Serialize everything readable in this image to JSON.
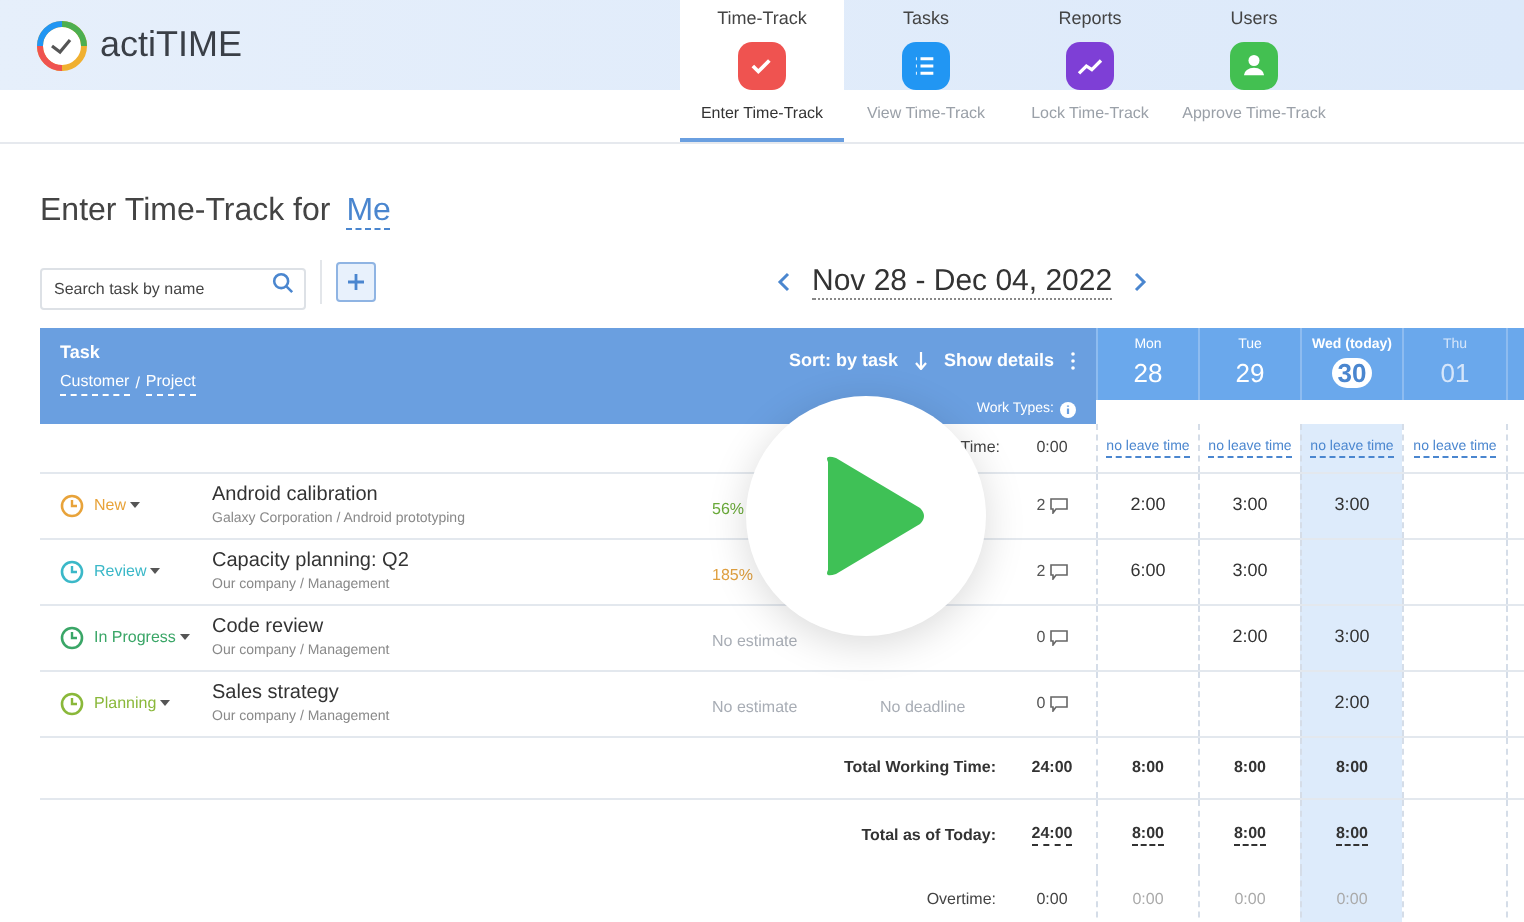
{
  "header": {
    "logo": "actiTIME",
    "tabs": [
      {
        "label": "Time-Track",
        "selected": true,
        "kind": "check"
      },
      {
        "label": "Tasks",
        "selected": false,
        "kind": "list"
      },
      {
        "label": "Reports",
        "selected": false,
        "kind": "chart"
      },
      {
        "label": "Users",
        "selected": false,
        "kind": "user"
      }
    ]
  },
  "subtabs": [
    {
      "label": "Enter Time-Track",
      "selected": true
    },
    {
      "label": "View Time-Track",
      "selected": false
    },
    {
      "label": "Lock Time-Track",
      "selected": false
    },
    {
      "label": "Approve Time-Track",
      "selected": false
    }
  ],
  "title": "Enter Time-Track for",
  "user": "Me",
  "search": {
    "placeholder": "Search task by name"
  },
  "date_range": "Nov 28 - Dec 04, 2022",
  "table": {
    "task_header": "Task",
    "customer_link": "Customer",
    "separator": "/",
    "project_link": "Project",
    "sort": "Sort: by task",
    "show_details": "Show details",
    "work_types": "Work Types:",
    "days": [
      {
        "weekday": "Mon",
        "date": "28",
        "today": false,
        "future": false
      },
      {
        "weekday": "Tue",
        "date": "29",
        "today": false,
        "future": false
      },
      {
        "weekday": "Wed (today)",
        "date": "30",
        "today": true,
        "future": false
      },
      {
        "weekday": "Thu",
        "date": "01",
        "today": false,
        "future": true
      }
    ],
    "leave_row": {
      "label": "Time:",
      "total": "0:00",
      "cells": [
        "no leave time",
        "no leave time",
        "no leave time",
        "no leave time"
      ]
    },
    "rows": [
      {
        "status": "New",
        "color": "#e8a33a",
        "name": "Android calibration",
        "path": "Galaxy Corporation / Android prototyping",
        "estimate": {
          "text": "56%",
          "color": "#6aaa3a"
        },
        "comments": "2",
        "hours": [
          {
            "kind": "time",
            "value": "2:00"
          },
          {
            "kind": "time",
            "value": "3:00"
          },
          {
            "kind": "time",
            "value": "3:00"
          },
          {
            "kind": "blank"
          }
        ]
      },
      {
        "status": "Review",
        "color": "#3bb8c8",
        "name": "Capacity planning: Q2",
        "path": "Our company / Management",
        "estimate": {
          "text": "185%",
          "color": "#e0a040"
        },
        "comments": "2",
        "hours": [
          {
            "kind": "time",
            "value": "6:00"
          },
          {
            "kind": "time",
            "value": "3:00"
          },
          {
            "kind": "blank"
          },
          {
            "kind": "blank"
          }
        ]
      },
      {
        "status": "In Progress",
        "color": "#3aa667",
        "name": "Code review",
        "path": "Our company / Management",
        "estimate": {
          "text": "No estimate",
          "color": "#a8adb5"
        },
        "comments": "0",
        "hours": [
          {
            "kind": "blank"
          },
          {
            "kind": "time",
            "value": "2:00"
          },
          {
            "kind": "time",
            "value": "3:00"
          },
          {
            "kind": "blank"
          }
        ]
      },
      {
        "status": "Planning",
        "color": "#8ab83a",
        "name": "Sales strategy",
        "path": "Our company / Management",
        "estimate": {
          "text": "No estimate",
          "color": "#a8adb5"
        },
        "deadline": "No deadline",
        "comments": "0",
        "hours": [
          {
            "kind": "blank"
          },
          {
            "kind": "blank"
          },
          {
            "kind": "time",
            "value": "2:00"
          },
          {
            "kind": "blank"
          }
        ]
      }
    ],
    "totals": [
      {
        "label": "Total Working Time:",
        "total": "24:00",
        "kind": "bold",
        "values": [
          {
            "kind": "time",
            "value": "8:00"
          },
          {
            "kind": "time",
            "value": "8:00"
          },
          {
            "kind": "time",
            "value": "8:00"
          },
          {
            "kind": "blank"
          }
        ]
      },
      {
        "label": "Total as of Today:",
        "total": "24:00",
        "kind": "dotted",
        "values": [
          {
            "kind": "time",
            "value": "8:00"
          },
          {
            "kind": "time",
            "value": "8:00"
          },
          {
            "kind": "time",
            "value": "8:00"
          },
          {
            "kind": "blank"
          }
        ]
      },
      {
        "label": "Overtime:",
        "total": "0:00",
        "kind": "muted",
        "values": [
          {
            "kind": "time",
            "value": "0:00"
          },
          {
            "kind": "time",
            "value": "0:00"
          },
          {
            "kind": "time",
            "value": "0:00"
          },
          {
            "kind": "blank"
          }
        ]
      }
    ]
  }
}
